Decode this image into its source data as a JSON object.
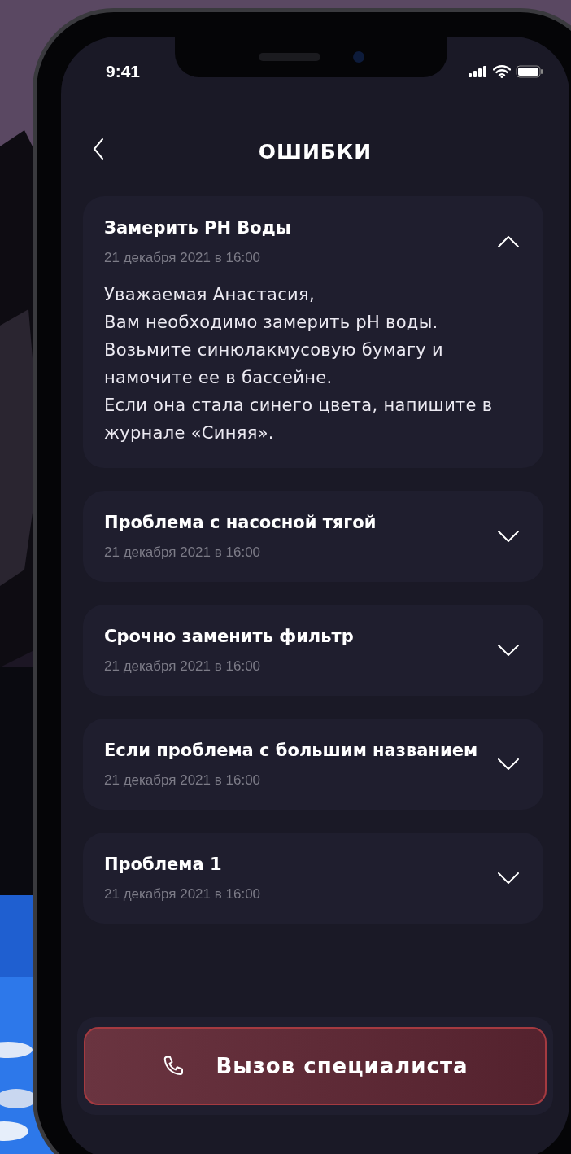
{
  "status_bar": {
    "time": "9:41"
  },
  "header": {
    "title": "ОШИБКИ"
  },
  "errors": [
    {
      "title": "Замерить PH Воды",
      "date": "21 декабря 2021 в 16:00",
      "expanded": true,
      "body": [
        "Уважаемая Анастасия,",
        "Вам необходимо замерить pH воды.",
        "Возьмите синюлакмусовую бумагу и намочите ее в бассейне.",
        "Если она стала синего цвета, напишите в журнале «Синяя»."
      ]
    },
    {
      "title": "Проблема с насосной тягой",
      "date": "21 декабря 2021 в 16:00",
      "expanded": false
    },
    {
      "title": "Срочно заменить фильтр",
      "date": "21 декабря 2021 в 16:00",
      "expanded": false
    },
    {
      "title": "Если проблема с большим названием",
      "date": "21 декабря 2021 в 16:00",
      "expanded": false
    },
    {
      "title": "Проблема 1",
      "date": "21 декабря 2021 в 16:00",
      "expanded": false
    }
  ],
  "call_button": {
    "label": "Вызов специалиста"
  }
}
